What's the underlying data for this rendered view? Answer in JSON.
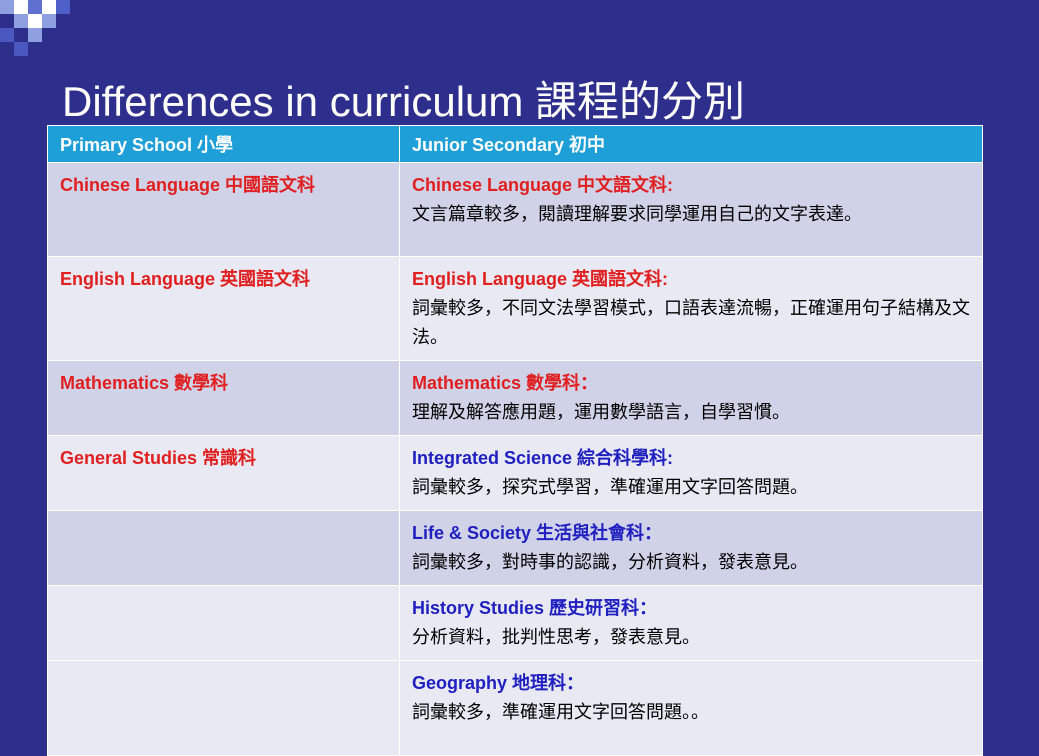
{
  "title": "Differences in curriculum 課程的分別",
  "header": {
    "col1": "Primary School 小學",
    "col2": "Junior Secondary 初中"
  },
  "rows": [
    {
      "primary": "Chinese Language 中國語文科",
      "secondary_title": "Chinese Language 中文語文科:",
      "secondary_desc": "文言篇章較多，閱讀理解要求同學運用自己的文字表達。"
    },
    {
      "primary": "English Language 英國語文科",
      "secondary_title": "English Language 英國語文科:",
      "secondary_desc": "詞彙較多，不同文法學習模式，口語表達流暢，正確運用句子結構及文法。"
    },
    {
      "primary": "Mathematics 數學科",
      "secondary_title": "Mathematics 數學科：",
      "secondary_desc": "理解及解答應用題，運用數學語言，自學習慣。"
    },
    {
      "primary": "General Studies 常識科",
      "secondary_title": "Integrated Science 綜合科學科:",
      "secondary_desc": "詞彙較多，探究式學習，準確運用文字回答問題。"
    },
    {
      "primary": "",
      "secondary_title": "Life & Society 生活與社會科：",
      "secondary_desc": "詞彙較多，對時事的認識，分析資料，發表意見。"
    },
    {
      "primary": "",
      "secondary_title": "History Studies 歷史研習科：",
      "secondary_desc": "分析資料，批判性思考，發表意見。"
    },
    {
      "primary": "",
      "secondary_title": "Geography 地理科：",
      "secondary_desc": "詞彙較多，準確運用文字回答問題。。"
    }
  ],
  "colors": {
    "background": "#2e2e8c",
    "header_bg": "#1e9fd8",
    "primary_text": "#e02020",
    "secondary_text": "#2020c0",
    "row_odd": "#d0d2e8",
    "row_even": "#e8e9f3"
  }
}
